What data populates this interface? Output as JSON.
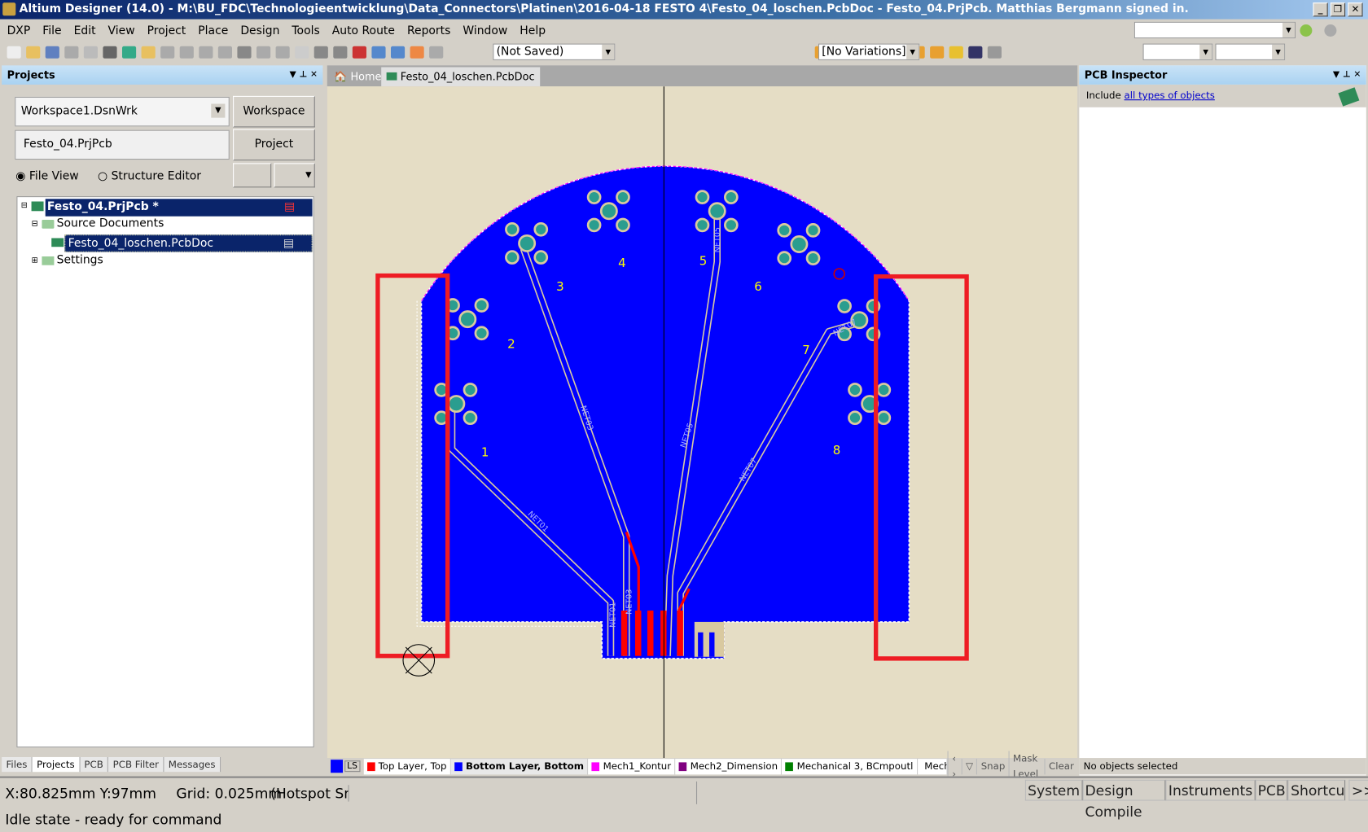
{
  "window": {
    "title": "Altium Designer (14.0) - M:\\BU_FDC\\Technologieentwicklung\\Data_Connectors\\Platinen\\2016-04-18 FESTO 4\\Festo_04_loschen.PcbDoc - Festo_04.PrjPcb. Matthias Bergmann signed in."
  },
  "menu": [
    "DXP",
    "File",
    "Edit",
    "View",
    "Project",
    "Place",
    "Design",
    "Tools",
    "Auto Route",
    "Reports",
    "Window",
    "Help"
  ],
  "toolbar": {
    "saved_state": "(Not Saved)",
    "variations": "[No Variations]"
  },
  "projects_panel": {
    "title": "Projects",
    "workspace_value": "Workspace1.DsnWrk",
    "workspace_button": "Workspace",
    "project_value": "Festo_04.PrjPcb",
    "project_button": "Project",
    "radio_file_view": "File View",
    "radio_structure_editor": "Structure Editor",
    "tree": {
      "project": "Festo_04.PrjPcb *",
      "source_documents": "Source Documents",
      "pcb_doc": "Festo_04_loschen.PcbDoc",
      "settings": "Settings"
    },
    "bottom_tabs": [
      "Files",
      "Projects",
      "PCB",
      "PCB Filter",
      "Messages"
    ]
  },
  "doc_tabs": {
    "home": "Home",
    "pcb": "Festo_04_loschen.PcbDoc"
  },
  "pcb": {
    "pad_labels": [
      "1",
      "2",
      "3",
      "4",
      "5",
      "6",
      "7",
      "8"
    ],
    "net_labels": [
      "NET01",
      "NET03",
      "NET05",
      "NET07",
      "NET01",
      "NET03",
      "NET05",
      "NET07"
    ],
    "colors": {
      "background": "#e5ddc5",
      "bottom_layer": "#0000ff",
      "top_layer": "#ff0000",
      "trace": "#d9c9a0"
    }
  },
  "layer_bar": {
    "ls": "LS",
    "layers": [
      {
        "name": "Top Layer, Top",
        "color": "#ff0000"
      },
      {
        "name": "Bottom Layer, Bottom",
        "color": "#0000ff",
        "active": true
      },
      {
        "name": "Mech1_Kontur",
        "color": "#ff00ff"
      },
      {
        "name": "Mech2_Dimension",
        "color": "#800080"
      },
      {
        "name": "Mechanical 3, BCmpoutl",
        "color": "#008000"
      },
      {
        "name": "Mechar",
        "color": "#808000"
      }
    ],
    "snap": "Snap",
    "mask_level": "Mask Level",
    "clear": "Clear"
  },
  "inspector": {
    "title": "PCB Inspector",
    "include": "Include",
    "link": "all types of objects",
    "status": "No objects selected"
  },
  "status": {
    "coords": "X:80.825mm Y:97mm",
    "grid": "Grid: 0.025mm",
    "hotspot": "(Hotspot Sna",
    "state": "Idle state - ready for command",
    "panels": [
      "System",
      "Design Compile",
      "Instruments",
      "PCB",
      "Shortcuts",
      ">>"
    ]
  }
}
